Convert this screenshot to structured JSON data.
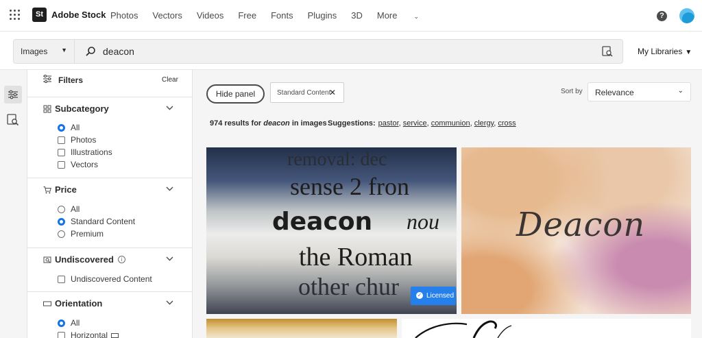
{
  "nav": {
    "brand": "Adobe Stock",
    "logo_text": "St",
    "links": [
      "Photos",
      "Vectors",
      "Videos",
      "Free",
      "Fonts",
      "Plugins",
      "3D"
    ],
    "more": "More",
    "help": "?"
  },
  "search": {
    "type": "Images",
    "query": "deacon",
    "libraries": "My Libraries"
  },
  "filters": {
    "title": "Filters",
    "clear": "Clear",
    "subcategory": {
      "title": "Subcategory",
      "options": [
        "All",
        "Photos",
        "Illustrations",
        "Vectors"
      ],
      "selected": "All"
    },
    "price": {
      "title": "Price",
      "options": [
        "All",
        "Standard Content",
        "Premium"
      ],
      "selected": "Standard Content"
    },
    "undiscovered": {
      "title": "Undiscovered",
      "info": "i",
      "option": "Undiscovered Content"
    },
    "orientation": {
      "title": "Orientation",
      "options": [
        "All",
        "Horizontal"
      ],
      "selected": "All"
    }
  },
  "results": {
    "hide_panel": "Hide panel",
    "chip": "Standard Content",
    "chip_close": "✕",
    "sort_label": "Sort by",
    "sort_value": "Relevance",
    "count_prefix": "974 results for",
    "count_query": "deacon",
    "count_suffix": "in images",
    "suggestions_label": "Suggestions:",
    "suggestions": [
      "pastor",
      "service",
      "communion",
      "clergy",
      "cross"
    ],
    "licensed": "Licensed",
    "tile2_text": "Deacon",
    "tile1_words": [
      "removal: dec",
      "sense 2 fron",
      "deacon",
      "nou",
      "the Roman",
      "other chur"
    ]
  },
  "colors": {
    "accent": "#1473e6",
    "licensed_badge": "#2680eb"
  }
}
